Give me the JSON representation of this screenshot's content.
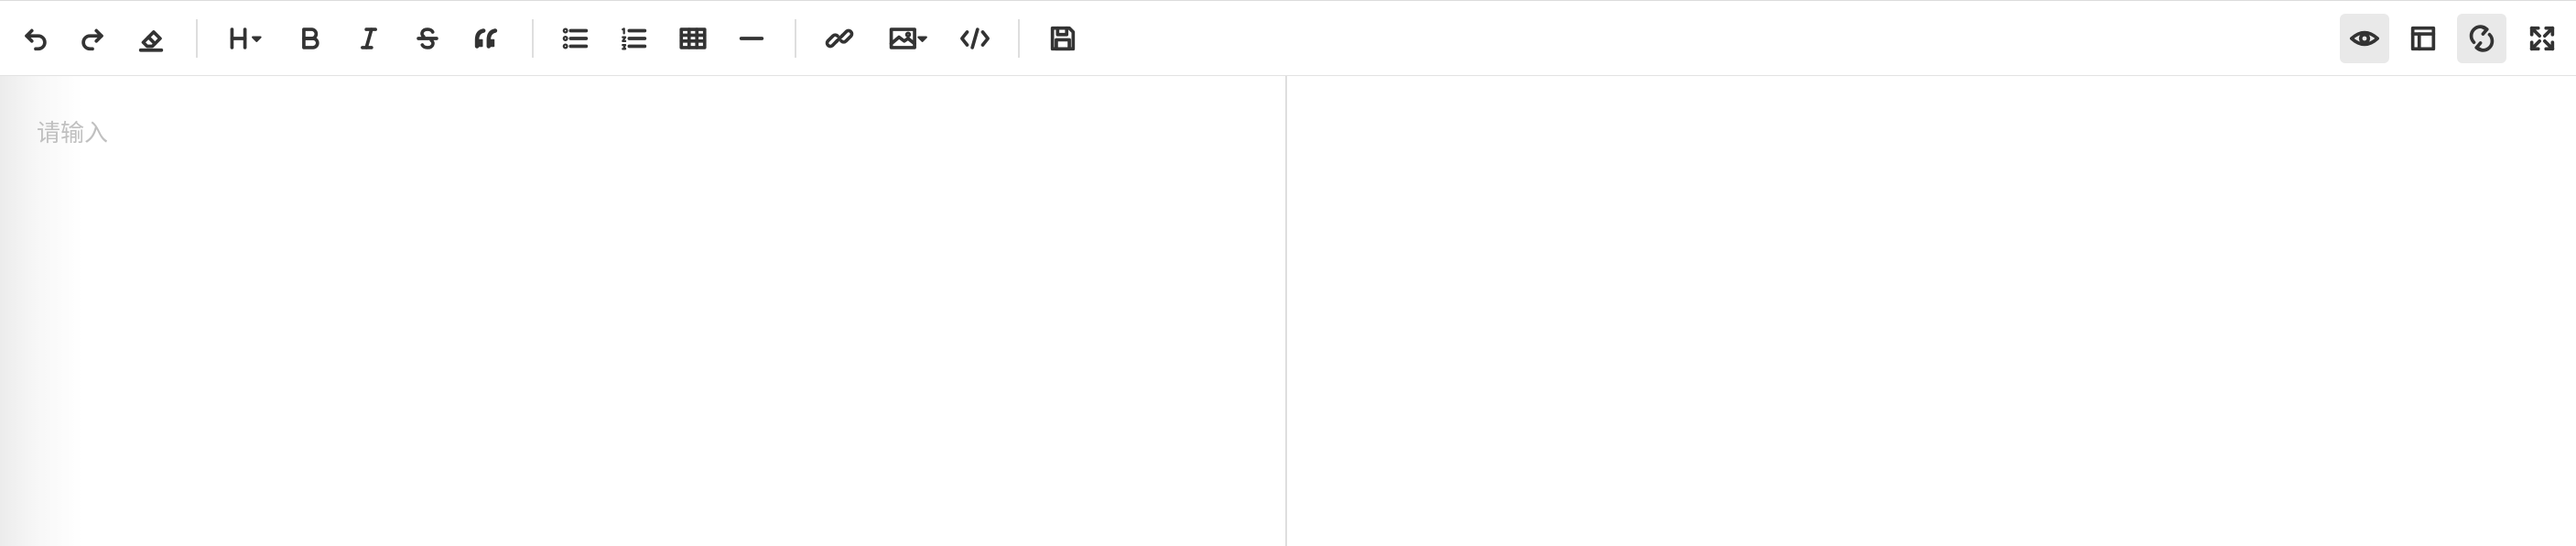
{
  "editor": {
    "placeholder": "请输入"
  },
  "toolbar": {
    "left_groups": [
      [
        "undo",
        "redo",
        "clear-format"
      ],
      [
        "heading-dropdown",
        "bold",
        "italic",
        "strikethrough",
        "blockquote"
      ],
      [
        "unordered-list",
        "ordered-list",
        "table",
        "horizontal-rule"
      ],
      [
        "link",
        "image-dropdown",
        "code"
      ],
      [
        "save"
      ]
    ],
    "right_items": [
      {
        "name": "preview",
        "active": true
      },
      {
        "name": "sidebar-layout",
        "active": false
      },
      {
        "name": "sync-scroll",
        "active": true
      },
      {
        "name": "fullscreen",
        "active": false
      }
    ]
  },
  "colors": {
    "icon": "#333333",
    "active_bg": "#e9e9e9",
    "divider": "#dedede",
    "placeholder": "#c0c0c0"
  }
}
